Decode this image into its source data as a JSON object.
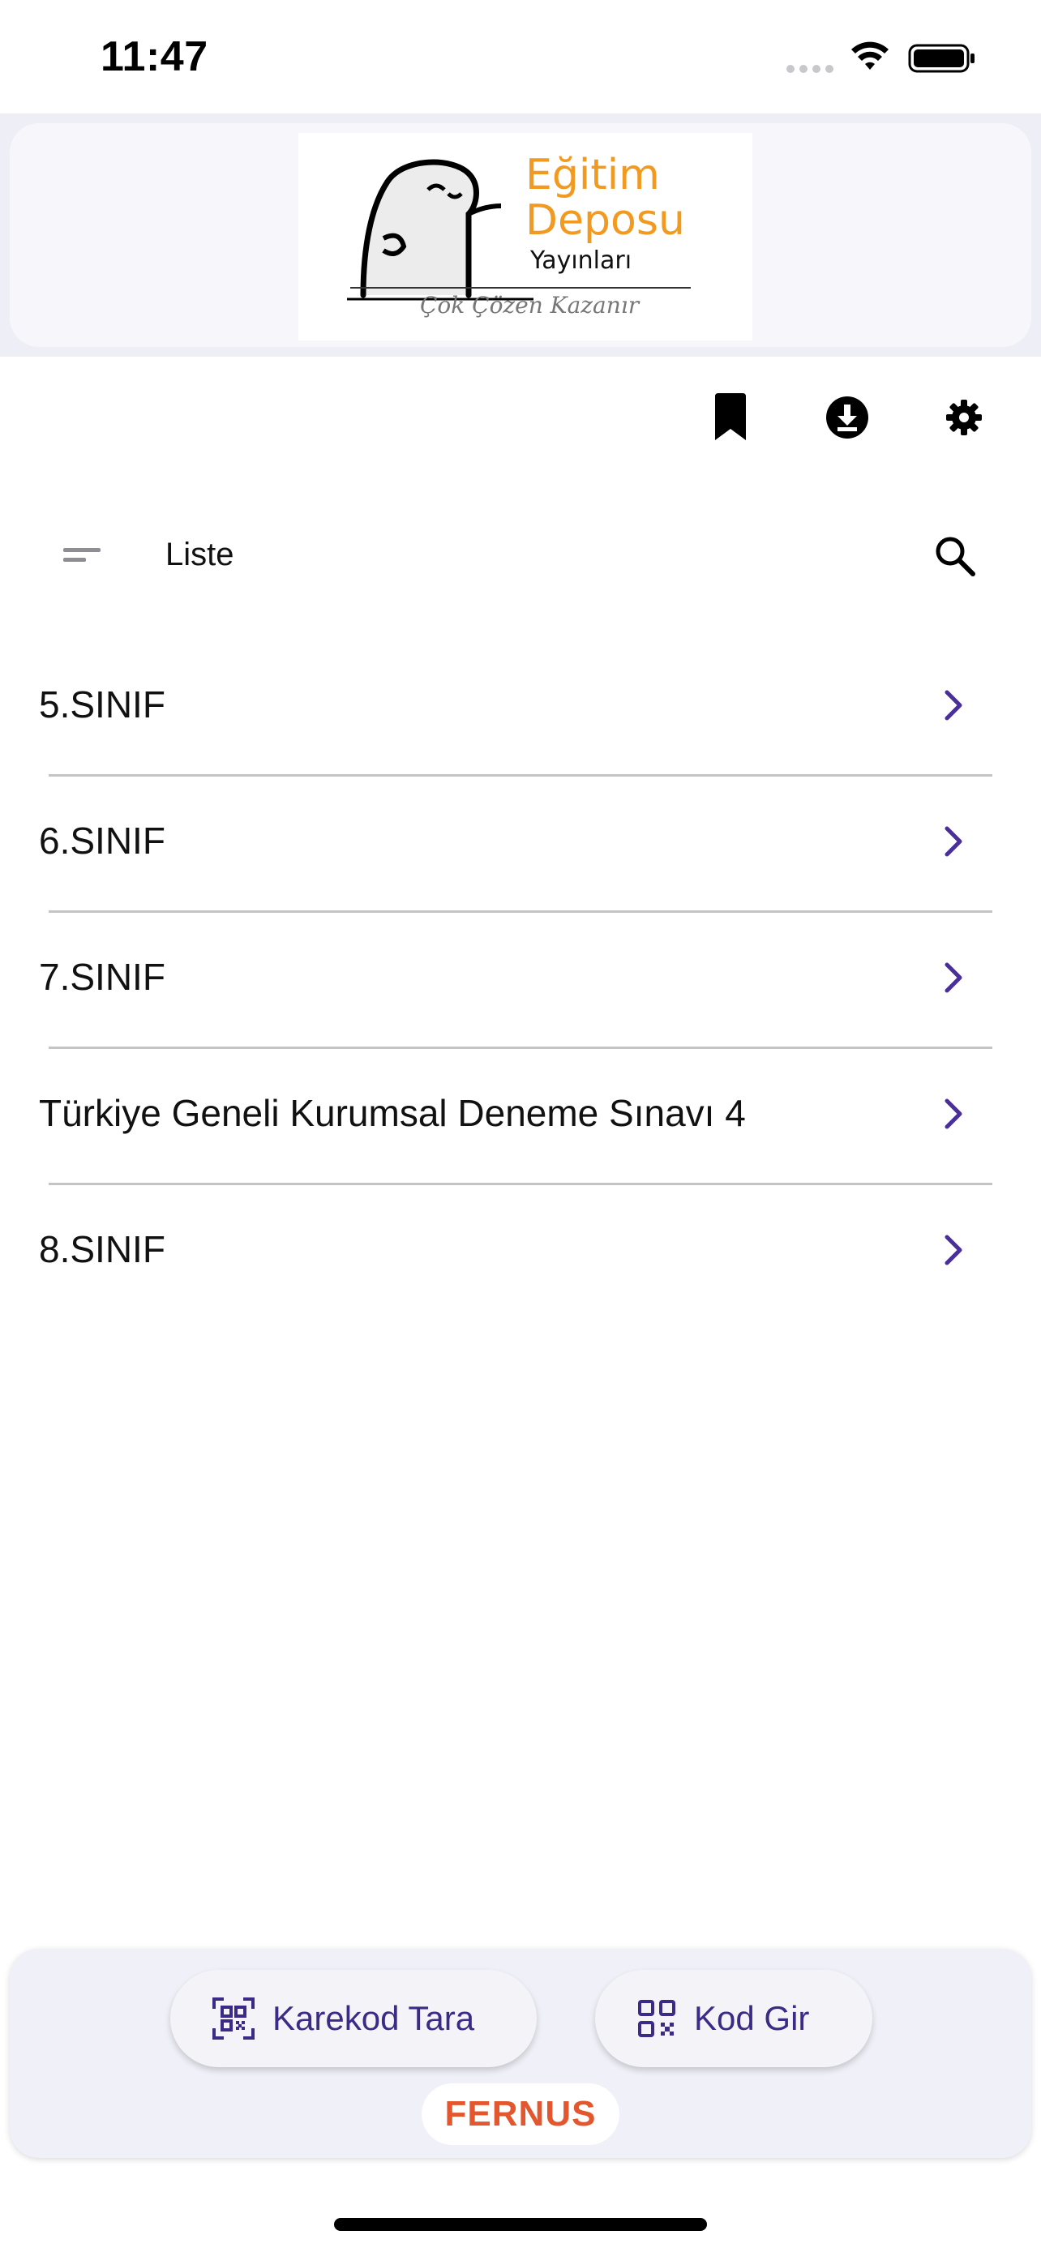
{
  "status_bar": {
    "time": "11:47"
  },
  "header": {
    "logo": {
      "title_line1": "Eğitim",
      "title_line2": "Deposu",
      "subtitle": "Yayınları",
      "slogan": "Çok Çözen Kazanır"
    }
  },
  "toolbar": {
    "icons": [
      "bookmark-icon",
      "download-icon",
      "settings-icon"
    ]
  },
  "list_header": {
    "title": "Liste"
  },
  "list": {
    "items": [
      {
        "label": "5.SINIF"
      },
      {
        "label": "6.SINIF"
      },
      {
        "label": "7.SINIF"
      },
      {
        "label": "Türkiye Geneli Kurumsal Deneme Sınavı 4"
      },
      {
        "label": "8.SINIF"
      }
    ]
  },
  "bottom": {
    "scan_label": "Karekod Tara",
    "code_label": "Kod Gir",
    "brand": "FERNUS"
  },
  "colors": {
    "accent": "#3b2a86",
    "chevron": "#4a2f9a",
    "brand_orange": "#e4572e",
    "logo_orange": "#f29a1f"
  }
}
